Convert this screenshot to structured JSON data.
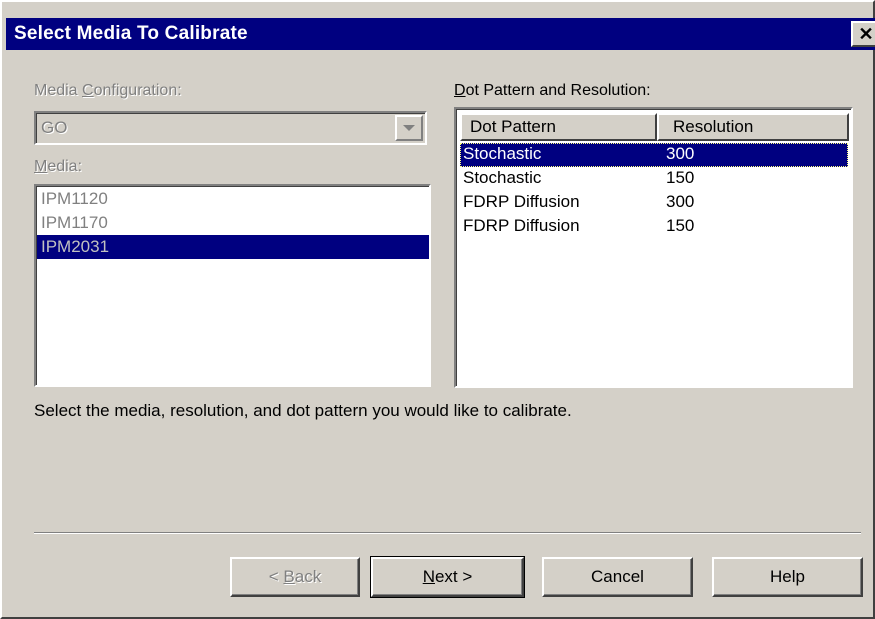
{
  "window": {
    "title": "Select Media To Calibrate",
    "close_glyph": "✕"
  },
  "media_configuration": {
    "label_pre": "Media ",
    "label_accel": "C",
    "label_post": "onfiguration:",
    "value": "GO",
    "enabled": false
  },
  "media": {
    "label_accel": "M",
    "label_post": "edia:",
    "items": [
      "IPM1120",
      "IPM1170",
      "IPM2031"
    ],
    "selected_index": 2
  },
  "dot_pattern": {
    "label_accel": "D",
    "label_post": "ot Pattern and Resolution:",
    "columns": [
      "Dot Pattern",
      "Resolution"
    ],
    "rows": [
      {
        "pattern": "Stochastic",
        "resolution": "300"
      },
      {
        "pattern": "Stochastic",
        "resolution": "150"
      },
      {
        "pattern": "FDRP Diffusion",
        "resolution": "300"
      },
      {
        "pattern": "FDRP Diffusion",
        "resolution": "150"
      }
    ],
    "selected_index": 0
  },
  "instruction": "Select the media, resolution, and dot pattern you would like to calibrate.",
  "buttons": {
    "back": {
      "pre": "< ",
      "accel": "B",
      "post": "ack",
      "enabled": false
    },
    "next": {
      "accel": "N",
      "post": "ext >",
      "default": true
    },
    "cancel": "Cancel",
    "help": "Help"
  },
  "colors": {
    "titlebar": "#000080",
    "selection": "#000080",
    "face": "#d4d0c8"
  }
}
